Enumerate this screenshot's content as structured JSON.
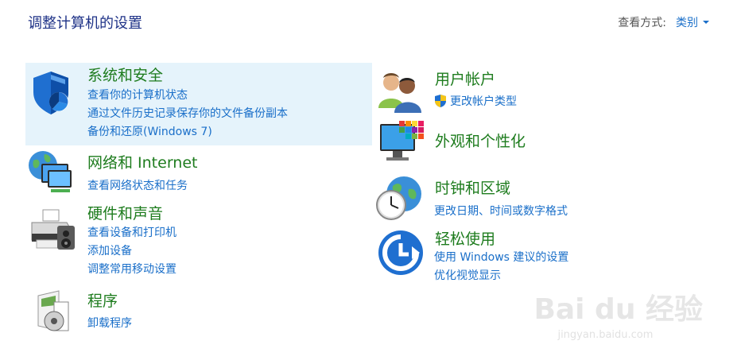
{
  "header": {
    "title": "调整计算机的设置",
    "view_by_label": "查看方式:",
    "view_by_value": "类别"
  },
  "categories": {
    "system_security": {
      "title": "系统和安全",
      "links": [
        "查看你的计算机状态",
        "通过文件历史记录保存你的文件备份副本",
        "备份和还原(Windows 7)"
      ]
    },
    "network": {
      "title": "网络和 Internet",
      "links": [
        "查看网络状态和任务"
      ]
    },
    "hardware": {
      "title": "硬件和声音",
      "links": [
        "查看设备和打印机",
        "添加设备",
        "调整常用移动设置"
      ]
    },
    "programs": {
      "title": "程序",
      "links": [
        "卸载程序"
      ]
    },
    "user_accounts": {
      "title": "用户帐户",
      "links": [
        "更改帐户类型"
      ]
    },
    "appearance": {
      "title": "外观和个性化",
      "links": []
    },
    "clock_region": {
      "title": "时钟和区域",
      "links": [
        "更改日期、时间或数字格式"
      ]
    },
    "ease_of_access": {
      "title": "轻松使用",
      "links": [
        "使用 Windows 建议的设置",
        "优化视觉显示"
      ]
    }
  },
  "watermark": {
    "main": "Bai du 经验",
    "sub": "jingyan.baidu.com"
  },
  "colors": {
    "title_blue": "#1e3287",
    "link_blue": "#1a6fc9",
    "category_green": "#1e7c1e",
    "hover_bg": "#e5f3fb"
  }
}
